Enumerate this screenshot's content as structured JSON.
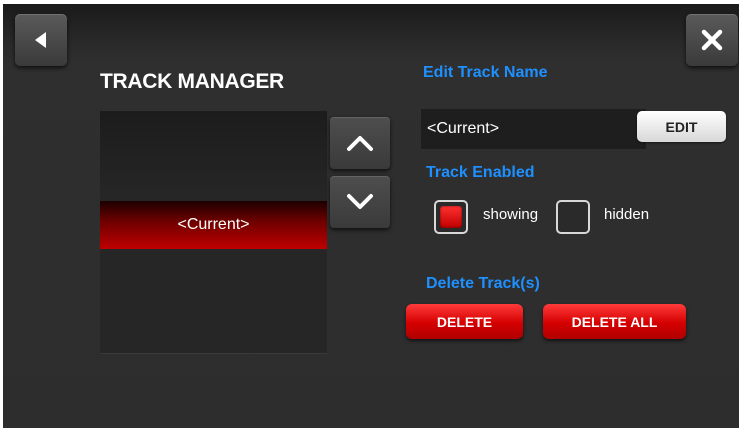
{
  "header": {
    "back_icon": "back-triangle-icon",
    "close_icon": "close-x-icon"
  },
  "track_manager": {
    "title": "TRACK MANAGER",
    "tracks": [
      "<Current>"
    ],
    "selected_index": 0,
    "up_icon": "chevron-up-icon",
    "down_icon": "chevron-down-icon"
  },
  "edit_name": {
    "label": "Edit Track Name",
    "value": "<Current>",
    "button_label": "EDIT"
  },
  "enabled": {
    "label": "Track Enabled",
    "showing_label": "showing",
    "hidden_label": "hidden",
    "selected": "showing"
  },
  "delete": {
    "label": "Delete Track(s)",
    "delete_label": "DELETE",
    "delete_all_label": "DELETE ALL"
  },
  "colors": {
    "accent_blue": "#1e90ff",
    "accent_red": "#d40000",
    "background": "#2d2d2d"
  }
}
